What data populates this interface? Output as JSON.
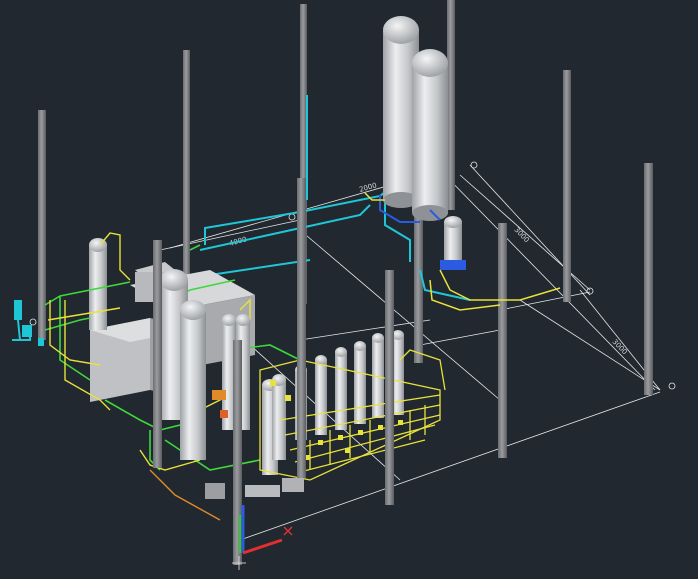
{
  "app": {
    "view": "3D isometric model - process plant"
  },
  "colors": {
    "background": "#212830",
    "grid_line": "#e6e6e6",
    "column": "#8d8f93",
    "column_dark": "#5b5d61",
    "vessel": "#c9cbce",
    "pipe_yellow": "#e8e23a",
    "pipe_green": "#3ed83a",
    "pipe_cyan": "#1fc7d6",
    "pipe_blue": "#2a5be0",
    "pipe_orange": "#e08a2a",
    "ucs_x": "#e03030",
    "ucs_y": "#2ad02a",
    "ucs_z": "#2a5be0"
  },
  "dimensions": {
    "d1": "4000",
    "d2": "2000",
    "d3": "3000",
    "d4": "3000"
  },
  "ucs": {
    "label": "UCS icon"
  }
}
